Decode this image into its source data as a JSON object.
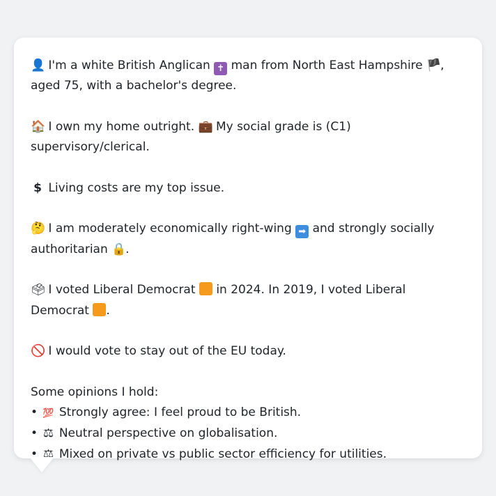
{
  "persona": {
    "identity": {
      "icon": "bust-in-silhouette-icon",
      "text_1": "I'm a white British Anglican",
      "icon_2": "latin-cross-icon",
      "text_2": "man from North East Hampshire",
      "icon_3": "england-flag-icon",
      "text_3": ", aged 75, with a bachelor's degree."
    },
    "home": {
      "icon": "house-icon",
      "text_1": "I own my home outright.",
      "icon_2": "briefcase-icon",
      "text_2": "My social grade is (C1) supervisory/clerical."
    },
    "issue": {
      "icon": "dollar-sign-icon",
      "text": "Living costs are my top issue."
    },
    "ideology": {
      "icon": "thinking-face-icon",
      "text_1": "I am moderately economically right-wing",
      "icon_2": "right-arrow-icon",
      "text_2": "and strongly socially authoritarian",
      "icon_3": "lock-icon",
      "text_3": "."
    },
    "votes": {
      "icon": "ballot-box-icon",
      "text_1": "I voted Liberal Democrat",
      "icon_2": "orange-square-icon",
      "text_2": "in 2024. In 2019, I voted Liberal Democrat",
      "icon_3": "orange-square-icon",
      "text_3": "."
    },
    "eu": {
      "icon": "no-entry-icon",
      "text": "I would vote to stay out of the EU today."
    },
    "opinions": {
      "heading": "Some opinions I hold:",
      "items": [
        {
          "icon": "hundred-points-icon",
          "text": "Strongly agree: I feel proud to be British."
        },
        {
          "icon": "balance-scale-icon",
          "text": "Neutral perspective on globalisation."
        },
        {
          "icon": "balance-scale-icon",
          "text": "Mixed on private vs public sector efficiency for utilities."
        }
      ]
    }
  },
  "colors": {
    "background": "#f1f2f4",
    "bubble": "#ffffff",
    "text": "#1f2328",
    "orange_square": "#f59a1c"
  }
}
